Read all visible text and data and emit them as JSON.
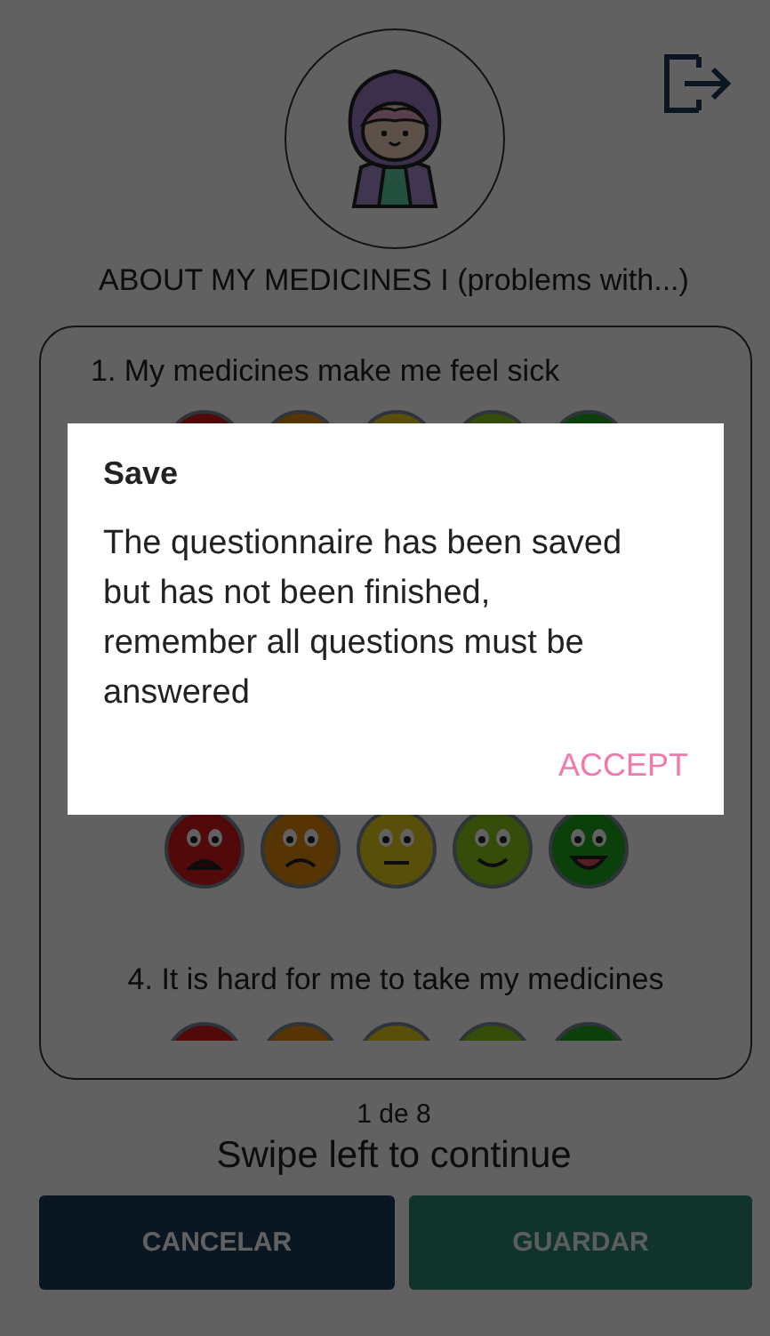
{
  "header": {
    "title": "ABOUT MY MEDICINES I (problems with...)"
  },
  "card": {
    "items": [
      {
        "kind": "question",
        "text": "1. My medicines make me feel sick"
      },
      {
        "kind": "faces"
      },
      {
        "kind": "faces"
      },
      {
        "kind": "question",
        "text": "4. It is hard for me to take my medicines"
      },
      {
        "kind": "faces"
      }
    ]
  },
  "pager": {
    "page": "1 de 8",
    "hint": "Swipe left to continue"
  },
  "buttons": [
    {
      "label": "CANCELAR",
      "kind": "cancel",
      "disabled": false
    },
    {
      "label": "GUARDAR",
      "kind": "save",
      "disabled": true
    }
  ],
  "dialog": {
    "title": "Save",
    "message": "The questionnaire has been saved but has not been finished, remember all questions must be answered",
    "action": "ACCEPT"
  }
}
